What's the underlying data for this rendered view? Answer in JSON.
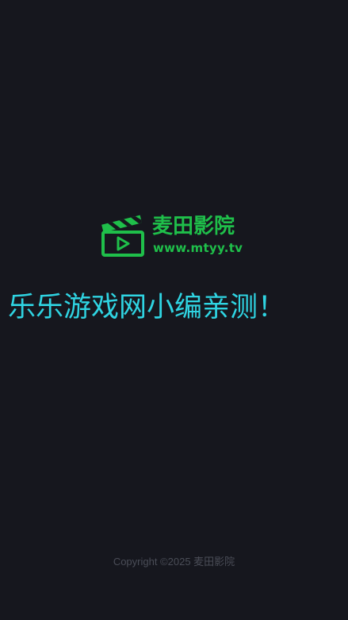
{
  "splash": {
    "brand_name": "麦田影院",
    "brand_url": "www.mtyy.tv",
    "logo_icon": "clapperboard-play-icon",
    "overlay_caption": "乐乐游戏网小编亲测！",
    "copyright": "Copyright ©2025 麦田影院"
  },
  "colors": {
    "background": "#16171e",
    "brand_green": "#1fbf4a",
    "caption_cyan": "#2fd4e2",
    "copyright_gray": "#4a4d57"
  }
}
